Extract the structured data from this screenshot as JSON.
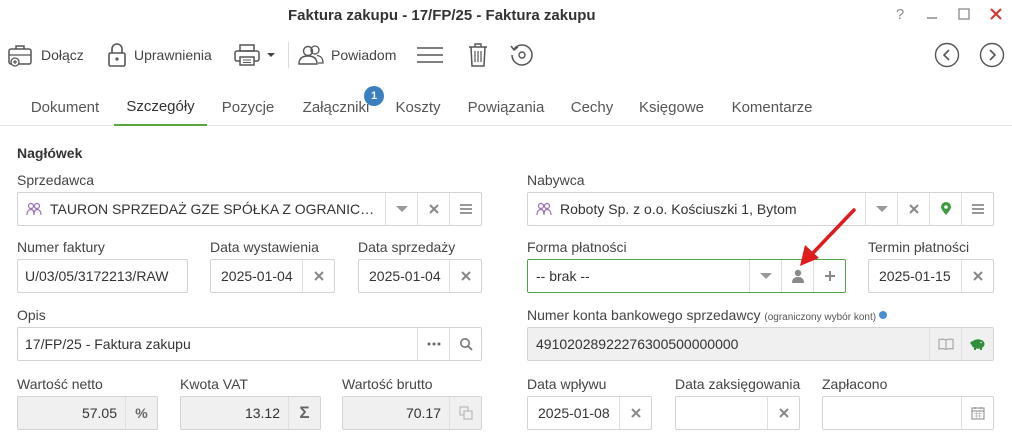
{
  "window": {
    "title": "Faktura zakupu - 17/FP/25 - Faktura zakupu",
    "help": "?"
  },
  "toolbar": {
    "attach": "Dołącz",
    "permissions": "Uprawnienia",
    "notify": "Powiadom"
  },
  "tabs": [
    "Dokument",
    "Szczegóły",
    "Pozycje",
    "Załączniki",
    "Koszty",
    "Powiązania",
    "Cechy",
    "Księgowe",
    "Komentarze"
  ],
  "active_tab": "Szczegóły",
  "attachments_badge": "1",
  "header": {
    "title": "Nagłówek",
    "seller_label": "Sprzedawca",
    "seller": "TAURON SPRZEDAŻ GZE SPÓŁKA Z OGRANICZONĄ ODPOWIEDZIALNOŚCIĄ",
    "buyer_label": "Nabywca",
    "buyer": "Roboty Sp. z o.o. Kościuszki 1, Bytom",
    "invoice_no_label": "Numer faktury",
    "invoice_no": "U/03/05/3172213/RAW",
    "issue_date_label": "Data wystawienia",
    "issue_date": "2025-01-04",
    "sale_date_label": "Data sprzedaży",
    "sale_date": "2025-01-04",
    "payment_form_label": "Forma płatności",
    "payment_form": "-- brak --",
    "payment_term_label": "Termin płatności",
    "payment_term": "2025-01-15",
    "description_label": "Opis",
    "description": "17/FP/25 - Faktura zakupu",
    "bank_account_label": "Numer konta bankowego sprzedawcy",
    "bank_account_note": "(ograniczony wybór kont)",
    "bank_account": "49102028922276300500000000",
    "net_label": "Wartość netto",
    "net": "57.05",
    "vat_label": "Kwota VAT",
    "vat": "13.12",
    "gross_label": "Wartość brutto",
    "gross": "70.17",
    "receipt_date_label": "Data wpływu",
    "receipt_date": "2025-01-08",
    "posting_date_label": "Data zaksięgowania",
    "posting_date": "",
    "paid_label": "Zapłacono",
    "paid": ""
  },
  "colors": {
    "accent_green": "#5aa63e",
    "badge_blue": "#3a7fc0",
    "annotation_red": "#e01b1b"
  }
}
